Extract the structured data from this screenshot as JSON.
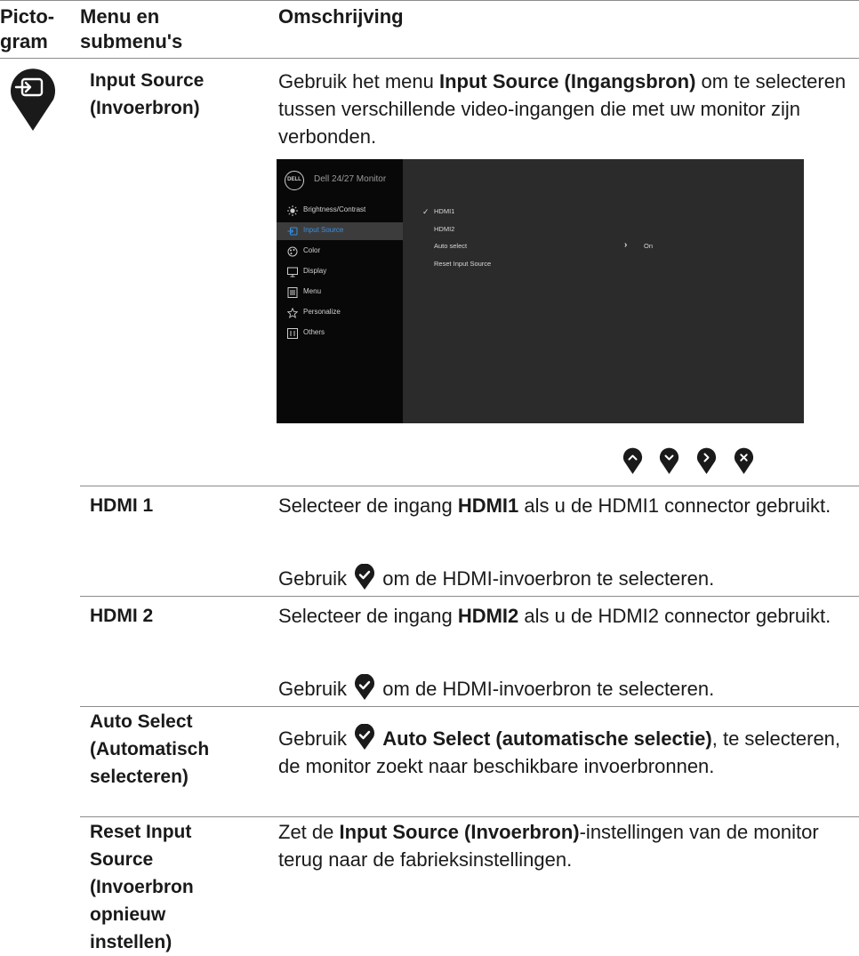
{
  "header": {
    "col1_line1": "Picto-",
    "col1_line2": "gram",
    "col2_line1": "Menu en",
    "col2_line2": "submenu's",
    "col3": "Omschrijving"
  },
  "input_source": {
    "term_line1": "Input Source",
    "term_line2": "(Invoerbron)",
    "desc_pre": "Gebruik het menu ",
    "desc_bold": "Input Source (Ingangsbron)",
    "desc_post": " om te selecteren tussen verschillende video-ingangen die met uw monitor zijn verbonden.",
    "icon": "input-source-icon"
  },
  "osd": {
    "logo": "DELL",
    "title": "Dell 24/27 Monitor",
    "menu": [
      {
        "label": "Brightness/Contrast",
        "icon": "brightness-icon"
      },
      {
        "label": "Input Source",
        "icon": "input-source-icon",
        "active": true
      },
      {
        "label": "Color",
        "icon": "color-icon"
      },
      {
        "label": "Display",
        "icon": "display-icon"
      },
      {
        "label": "Menu",
        "icon": "menu-icon"
      },
      {
        "label": "Personalize",
        "icon": "star-icon"
      },
      {
        "label": "Others",
        "icon": "others-icon"
      }
    ],
    "submenu": [
      "HDMI1",
      "HDMI2",
      "Auto select",
      "Reset Input Source"
    ],
    "auto_select_value": "On",
    "colors": {
      "accent": "#3a8fe0",
      "sidebar": "#080808",
      "panel": "#2b2b2b"
    }
  },
  "nav_buttons": [
    "up-icon",
    "down-icon",
    "right-icon",
    "close-icon"
  ],
  "rows": {
    "hdmi1": {
      "term": "HDMI 1",
      "sel_pre": "Selecteer de ingang ",
      "sel_bold": "HDMI1",
      "sel_post": " als u de HDMI1 connector gebruikt.",
      "use_pre": "Gebruik ",
      "use_post": " om de HDMI-invoerbron te selecteren."
    },
    "hdmi2": {
      "term": "HDMI 2",
      "sel_pre": "Selecteer de ingang ",
      "sel_bold": "HDMI2",
      "sel_post": " als u de HDMI2 connector gebruikt.",
      "use_pre": "Gebruik ",
      "use_post": " om de HDMI-invoerbron te selecteren."
    },
    "auto": {
      "term_line1": "Auto Select",
      "term_line2": "(Automatisch",
      "term_line3": "selecteren)",
      "pre": "Gebruik ",
      "bold": "Auto Select (automatische selectie)",
      "post": ", te selecteren, de monitor zoekt naar beschikbare invoerbronnen."
    },
    "reset": {
      "term_line1": "Reset Input",
      "term_line2": "Source",
      "term_line3": "(Invoerbron",
      "term_line4": "opnieuw",
      "term_line5": "instellen)",
      "pre": "Zet de ",
      "bold": "Input Source (Invoerbron)",
      "post": "-instellingen van de monitor terug naar de fabrieksinstellingen."
    }
  }
}
